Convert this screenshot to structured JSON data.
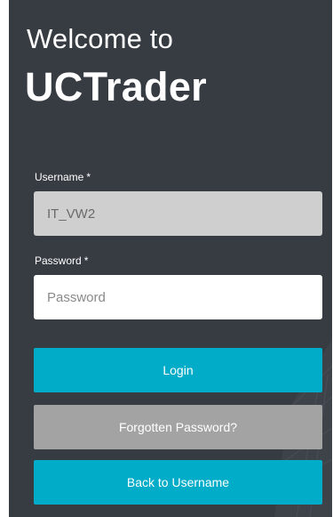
{
  "header": {
    "welcome": "Welcome to",
    "brand": "UCTrader"
  },
  "form": {
    "username_label": "Username",
    "username_value": "IT_VW2",
    "password_label": "Password",
    "password_placeholder": "Password",
    "required_marker": "*"
  },
  "actions": {
    "login_label": "Login",
    "forgot_label": "Forgotten Password?",
    "back_label": "Back to Username"
  },
  "colors": {
    "panel_bg": "#373b42",
    "accent": "#00acc8",
    "secondary": "#a3a3a3",
    "disabled_field": "#cfcfcf"
  }
}
